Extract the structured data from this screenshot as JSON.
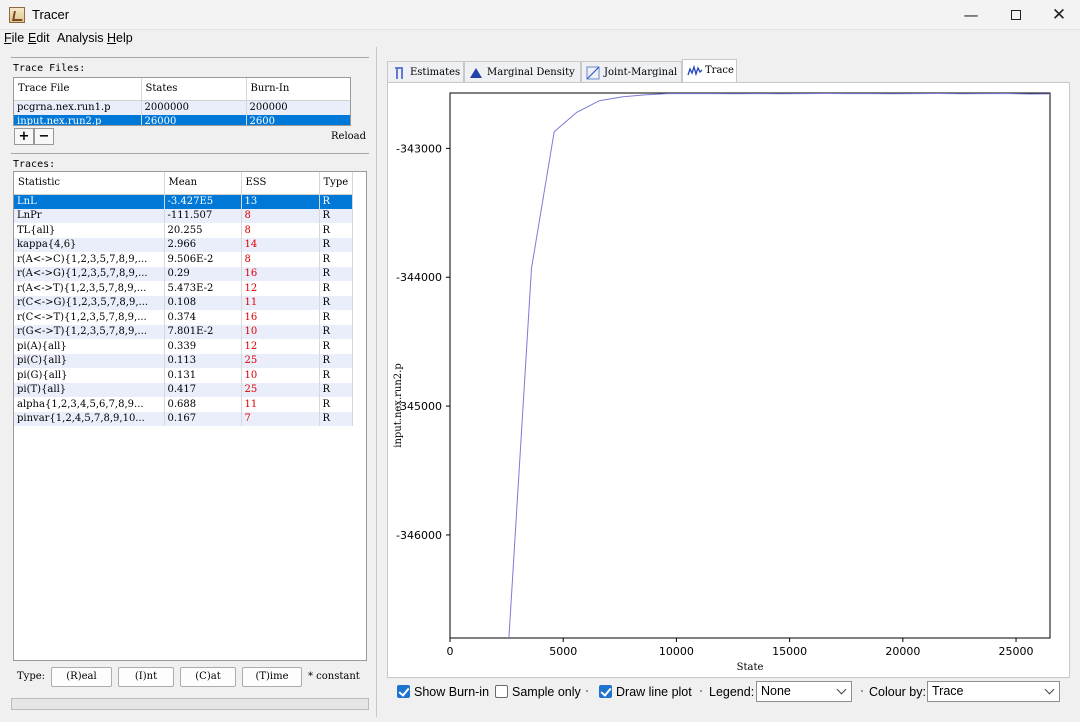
{
  "window": {
    "title": "Tracer",
    "min_label": "—",
    "close_label": "✕"
  },
  "menu": [
    {
      "key": "F",
      "rest": "ile"
    },
    {
      "key": "E",
      "rest": "dit"
    },
    {
      "key": "",
      "rest": "Analysis"
    },
    {
      "key": "H",
      "rest": "elp"
    }
  ],
  "trace_files": {
    "label": "Trace Files:",
    "columns": [
      "Trace File",
      "States",
      "Burn-In"
    ],
    "rows": [
      {
        "file": "pcgrna.nex.run1.p",
        "states": "2000000",
        "burnin": "200000"
      },
      {
        "file": "input.nex.run2.p",
        "states": "26000",
        "burnin": "2600"
      }
    ],
    "add_label": "+",
    "remove_label": "−",
    "reload_label": "Reload"
  },
  "traces": {
    "label": "Traces:",
    "columns": [
      "Statistic",
      "Mean",
      "ESS",
      "Type"
    ],
    "rows": [
      {
        "stat": "LnL",
        "mean": "-3.427E5",
        "ess": "13",
        "type": "R"
      },
      {
        "stat": "LnPr",
        "mean": "-111.507",
        "ess": "8",
        "type": "R"
      },
      {
        "stat": "TL{all}",
        "mean": "20.255",
        "ess": "8",
        "type": "R"
      },
      {
        "stat": "kappa{4,6}",
        "mean": "2.966",
        "ess": "14",
        "type": "R"
      },
      {
        "stat": "r(A<->C){1,2,3,5,7,8,9,...",
        "mean": "9.506E-2",
        "ess": "8",
        "type": "R"
      },
      {
        "stat": "r(A<->G){1,2,3,5,7,8,9,...",
        "mean": "0.29",
        "ess": "16",
        "type": "R"
      },
      {
        "stat": "r(A<->T){1,2,3,5,7,8,9,...",
        "mean": "5.473E-2",
        "ess": "12",
        "type": "R"
      },
      {
        "stat": "r(C<->G){1,2,3,5,7,8,9,...",
        "mean": "0.108",
        "ess": "11",
        "type": "R"
      },
      {
        "stat": "r(C<->T){1,2,3,5,7,8,9,...",
        "mean": "0.374",
        "ess": "16",
        "type": "R"
      },
      {
        "stat": "r(G<->T){1,2,3,5,7,8,9,...",
        "mean": "7.801E-2",
        "ess": "10",
        "type": "R"
      },
      {
        "stat": "pi(A){all}",
        "mean": "0.339",
        "ess": "12",
        "type": "R"
      },
      {
        "stat": "pi(C){all}",
        "mean": "0.113",
        "ess": "25",
        "type": "R"
      },
      {
        "stat": "pi(G){all}",
        "mean": "0.131",
        "ess": "10",
        "type": "R"
      },
      {
        "stat": "pi(T){all}",
        "mean": "0.417",
        "ess": "25",
        "type": "R"
      },
      {
        "stat": "alpha{1,2,3,4,5,6,7,8,9...",
        "mean": "0.688",
        "ess": "11",
        "type": "R"
      },
      {
        "stat": "pinvar{1,2,4,5,7,8,9,10...",
        "mean": "0.167",
        "ess": "7",
        "type": "R"
      }
    ],
    "selected_index": 0
  },
  "type_bar": {
    "label": "Type:",
    "buttons": [
      "(R)eal",
      "(I)nt",
      "(C)at",
      "(T)ime"
    ],
    "constant_label": "* constant"
  },
  "tabs": [
    {
      "label": "Estimates",
      "icon": "estimates-icon"
    },
    {
      "label": "Marginal Density",
      "icon": "marginal-density-icon"
    },
    {
      "label": "Joint-Marginal",
      "icon": "joint-marginal-icon"
    },
    {
      "label": "Trace",
      "icon": "trace-icon",
      "active": true
    }
  ],
  "controls": {
    "show_burnin": {
      "label": "Show Burn-in",
      "checked": true
    },
    "sample_only": {
      "label": "Sample only",
      "checked": false
    },
    "draw_line_plot": {
      "label": "Draw line plot",
      "checked": true
    },
    "legend": {
      "label": "Legend:",
      "value": "None"
    },
    "colour_by": {
      "label": "Colour by:",
      "value": "Trace"
    }
  },
  "chart_data": {
    "type": "line",
    "xlabel": "State",
    "ylabel": "input.nex.run2.p",
    "xlim": [
      0,
      26500
    ],
    "ylim": [
      -346800,
      -342570
    ],
    "xticks": [
      0,
      5000,
      10000,
      15000,
      20000,
      25000
    ],
    "yticks": [
      -343000,
      -344000,
      -345000,
      -346000
    ],
    "ytick_labels": [
      "-343000",
      "-344000",
      "-345000",
      "-346000"
    ],
    "color": "#7b7bd6",
    "series": [
      {
        "x": [
          2600,
          3600,
          4600,
          5600,
          6600,
          7600,
          8600,
          9600,
          10600,
          11600,
          12600,
          13600,
          14600,
          15600,
          16600,
          17600,
          18600,
          19600,
          20600,
          21600,
          22600,
          23600,
          24600,
          25600,
          26500
        ],
        "y": [
          -346800,
          -343930,
          -342870,
          -342720,
          -342630,
          -342600,
          -342585,
          -342575,
          -342575,
          -342575,
          -342576,
          -342575,
          -342576,
          -342575,
          -342574,
          -342575,
          -342575,
          -342576,
          -342575,
          -342574,
          -342576,
          -342575,
          -342574,
          -342578,
          -342577
        ]
      }
    ]
  }
}
